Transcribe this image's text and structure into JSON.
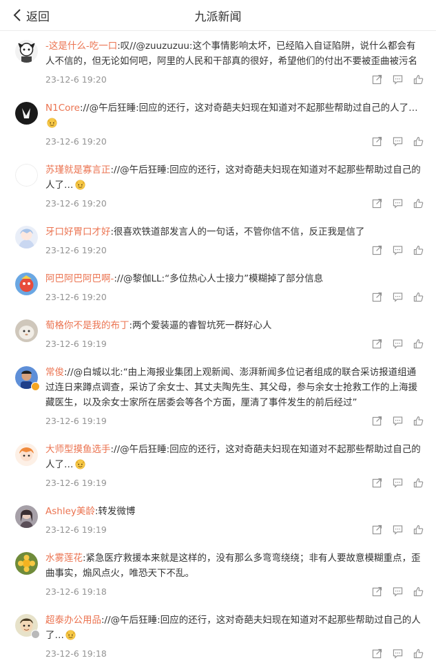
{
  "header": {
    "back_label": "返回",
    "title": "九派新闻"
  },
  "comments": [
    {
      "user": "-这是什么-吃一口",
      "text": ":叹//@zuuzuzuu:这个事情影响太坏，已经陷入自证陷阱，说什么都会有人不信的，但无论如何吧，阿里的人民和干部真的很好，希望他们的付出不要被歪曲被污名",
      "time": "23-12-6 19:20",
      "emoji": false
    },
    {
      "user": "N1Core",
      "text": "://@午后狂睡:回应的还行，这对奇葩夫妇现在知道对不起那些帮助过自己的人了…",
      "time": "23-12-6 19:20",
      "emoji": true
    },
    {
      "user": "苏瑾就是寡言正",
      "text": "://@午后狂睡:回应的还行，这对奇葩夫妇现在知道对不起那些帮助过自己的人了…",
      "time": "23-12-6 19:20",
      "emoji": true
    },
    {
      "user": "牙口好胃口才好",
      "text": ":很喜欢铁道部发言人的一句话，不管你信不信，反正我是信了",
      "time": "23-12-6 19:20",
      "emoji": false
    },
    {
      "user": "阿巴阿巴阿巴啊-",
      "text": "://@黎伽LL:“多位热心人士接力”模糊掉了部分信息",
      "time": "23-12-6 19:20",
      "emoji": false
    },
    {
      "user": "萄格你不是我的布丁",
      "text": ":两个爱装逼的睿智坑死一群好心人",
      "time": "23-12-6 19:19",
      "emoji": false
    },
    {
      "user": "常俊",
      "text": "://@白城以北:“由上海报业集团上观新闻、澎湃新闻多位记者组成的联合采访报道组通过连日来蹲点调查，采访了余女士、其丈夫陶先生、其父母，参与余女士抢救工作的上海援藏医生，以及余女士家所在居委会等各个方面，厘清了事件发生的前后经过”",
      "time": "23-12-6 19:19",
      "emoji": false
    },
    {
      "user": "大师型摸鱼选手",
      "text": "://@午后狂睡:回应的还行，这对奇葩夫妇现在知道对不起那些帮助过自己的人了…",
      "time": "23-12-6 19:19",
      "emoji": true
    },
    {
      "user": "Ashley美龄",
      "text": ":转发微博",
      "time": "23-12-6 19:19",
      "emoji": false
    },
    {
      "user": "水雾莲花",
      "text": ":紧急医疗救援本来就是这样的，没有那么多弯弯绕绕；非有人要故意模糊重点，歪曲事实，煽风点火，唯恐天下不乱。",
      "time": "23-12-6 19:18",
      "emoji": false
    },
    {
      "user": "超泰办公用品",
      "text": "://@午后狂睡:回应的还行，这对奇葩夫妇现在知道对不起那些帮助过自己的人了…",
      "time": "23-12-6 19:18",
      "emoji": true
    }
  ],
  "icons": {
    "share": "share-icon",
    "comment": "comment-icon",
    "like": "like-icon",
    "back": "chevron-left-icon"
  },
  "colors": {
    "username": "#eb7350",
    "time": "#939393",
    "icon": "#8f8f8f"
  }
}
